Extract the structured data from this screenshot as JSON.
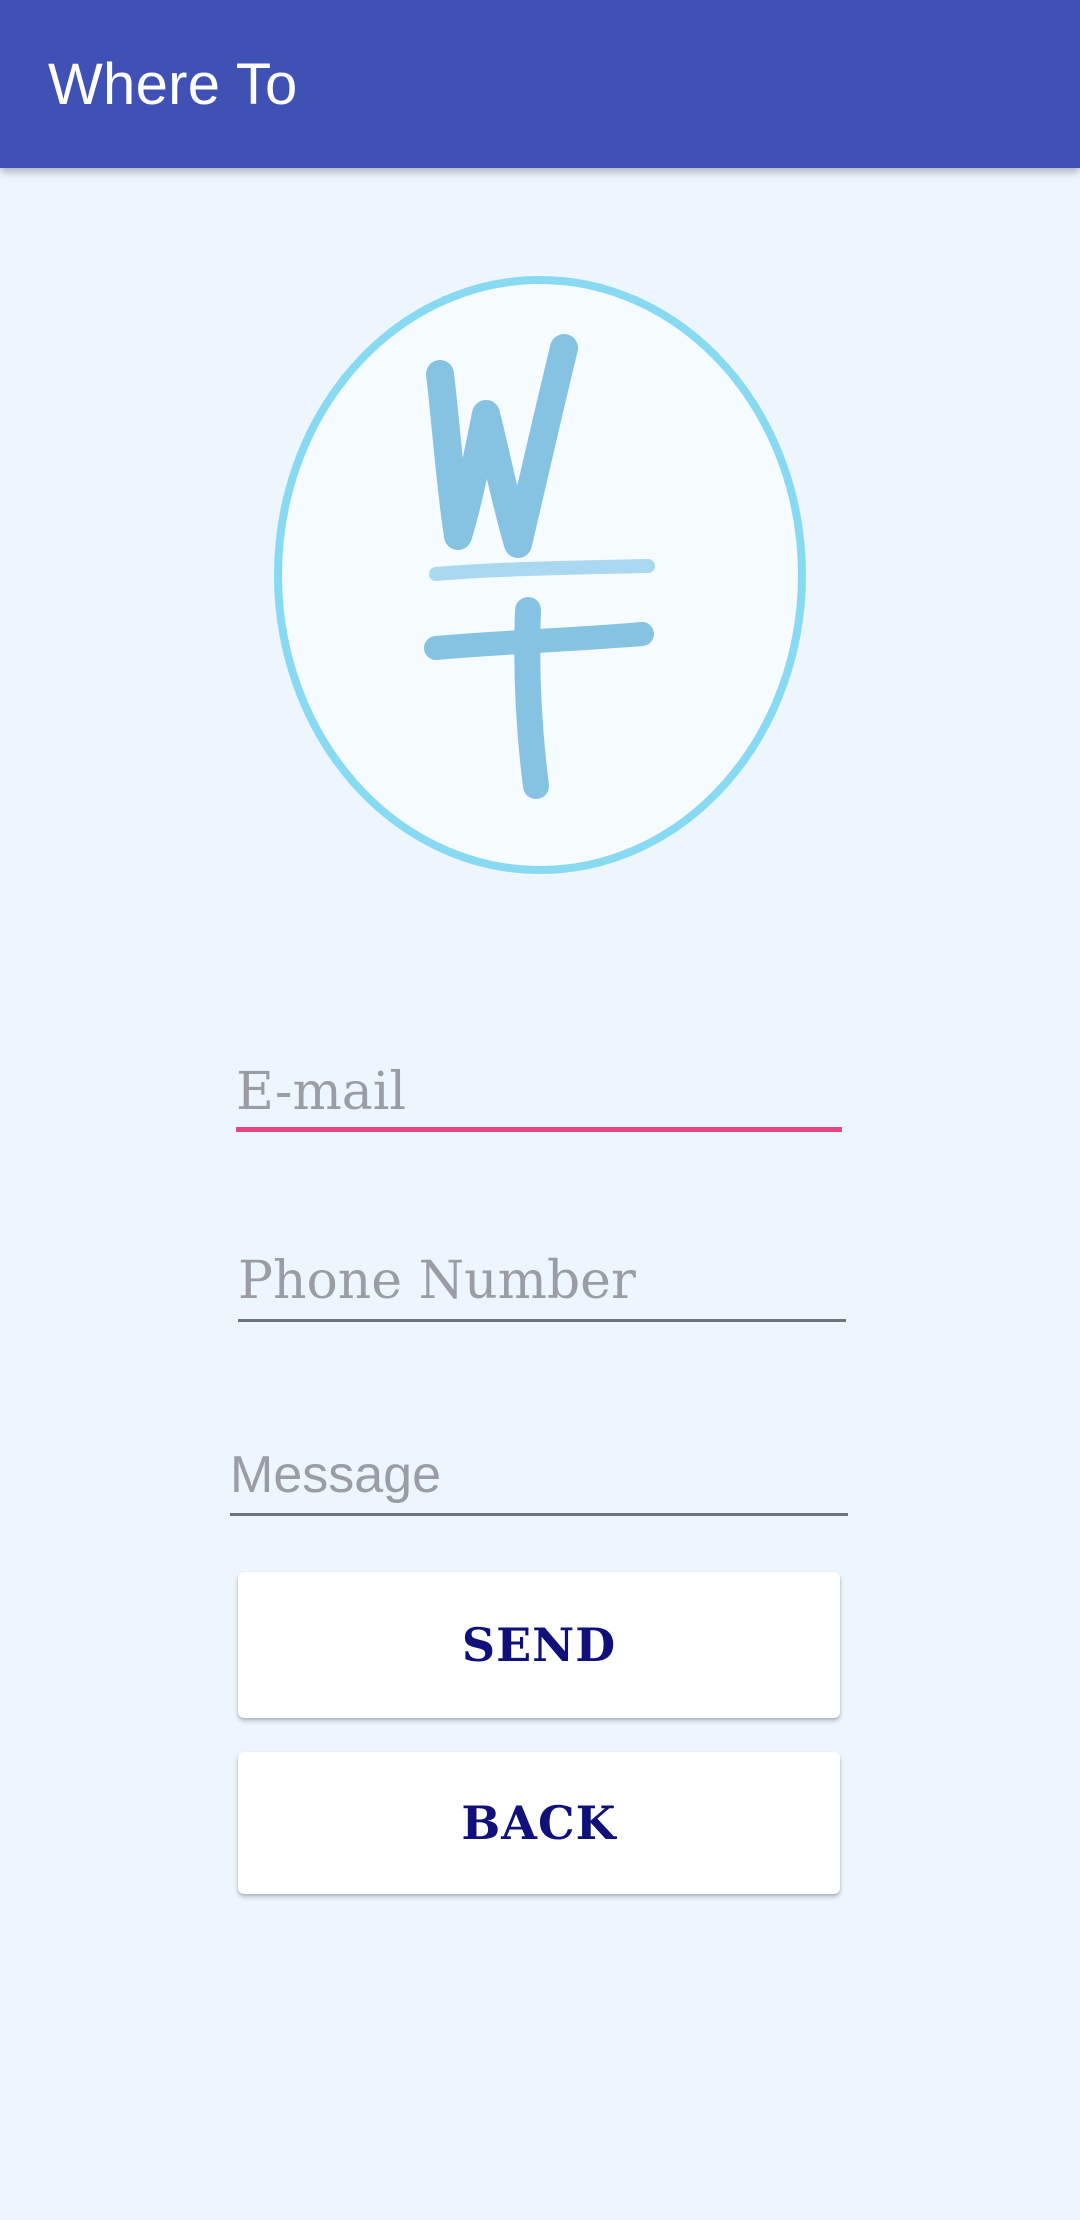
{
  "app_bar": {
    "title": "Where To",
    "color": "#3F51B5"
  },
  "logo": {
    "icon": "where-to-monogram-logo",
    "ring_color": "#87DAF1",
    "letter_color": "#86C3E3"
  },
  "form": {
    "email": {
      "placeholder": "E-mail",
      "value": "",
      "focused": true,
      "accent_color": "#E8457E"
    },
    "phone": {
      "placeholder": "Phone Number",
      "value": ""
    },
    "message": {
      "placeholder": "Message",
      "value": ""
    }
  },
  "buttons": {
    "send_label": "SEND",
    "back_label": "BACK",
    "label_color": "#0F1079"
  },
  "colors": {
    "background": "#EEF6FD"
  }
}
